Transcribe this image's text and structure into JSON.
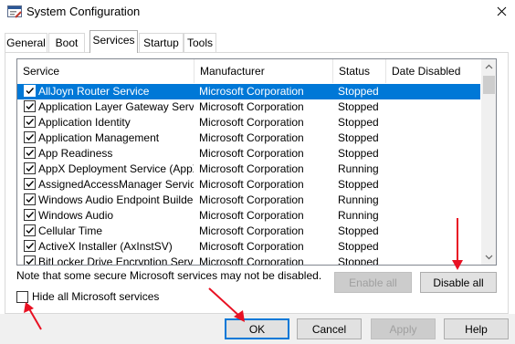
{
  "window": {
    "title": "System Configuration"
  },
  "tabs": [
    {
      "label": "General"
    },
    {
      "label": "Boot"
    },
    {
      "label": "Services"
    },
    {
      "label": "Startup"
    },
    {
      "label": "Tools"
    }
  ],
  "table": {
    "columns": [
      "Service",
      "Manufacturer",
      "Status",
      "Date Disabled"
    ],
    "rows": [
      {
        "service": "AllJoyn Router Service",
        "manufacturer": "Microsoft Corporation",
        "status": "Stopped",
        "date_disabled": "",
        "checked": true,
        "selected": true
      },
      {
        "service": "Application Layer Gateway Service",
        "manufacturer": "Microsoft Corporation",
        "status": "Stopped",
        "date_disabled": "",
        "checked": true
      },
      {
        "service": "Application Identity",
        "manufacturer": "Microsoft Corporation",
        "status": "Stopped",
        "date_disabled": "",
        "checked": true
      },
      {
        "service": "Application Management",
        "manufacturer": "Microsoft Corporation",
        "status": "Stopped",
        "date_disabled": "",
        "checked": true
      },
      {
        "service": "App Readiness",
        "manufacturer": "Microsoft Corporation",
        "status": "Stopped",
        "date_disabled": "",
        "checked": true
      },
      {
        "service": "AppX Deployment Service (AppX...",
        "manufacturer": "Microsoft Corporation",
        "status": "Running",
        "date_disabled": "",
        "checked": true
      },
      {
        "service": "AssignedAccessManager Service",
        "manufacturer": "Microsoft Corporation",
        "status": "Stopped",
        "date_disabled": "",
        "checked": true
      },
      {
        "service": "Windows Audio Endpoint Builder",
        "manufacturer": "Microsoft Corporation",
        "status": "Running",
        "date_disabled": "",
        "checked": true
      },
      {
        "service": "Windows Audio",
        "manufacturer": "Microsoft Corporation",
        "status": "Running",
        "date_disabled": "",
        "checked": true
      },
      {
        "service": "Cellular Time",
        "manufacturer": "Microsoft Corporation",
        "status": "Stopped",
        "date_disabled": "",
        "checked": true
      },
      {
        "service": "ActiveX Installer (AxInstSV)",
        "manufacturer": "Microsoft Corporation",
        "status": "Stopped",
        "date_disabled": "",
        "checked": true
      },
      {
        "service": "BitLocker Drive Encryption Service",
        "manufacturer": "Microsoft Corporation",
        "status": "Stopped",
        "date_disabled": "",
        "checked": true
      }
    ]
  },
  "note": "Note that some secure Microsoft services may not be disabled.",
  "buttons": {
    "enable_all": "Enable all",
    "disable_all": "Disable all",
    "ok": "OK",
    "cancel": "Cancel",
    "apply": "Apply",
    "help": "Help"
  },
  "hide_microsoft": {
    "label": "Hide all Microsoft services",
    "checked": false
  },
  "colors": {
    "selection": "#0078d7",
    "annotation_arrow": "#e81123"
  },
  "icons": [
    "app-icon",
    "close-icon",
    "scroll-up-icon",
    "scroll-down-icon",
    "checkmark-icon"
  ]
}
